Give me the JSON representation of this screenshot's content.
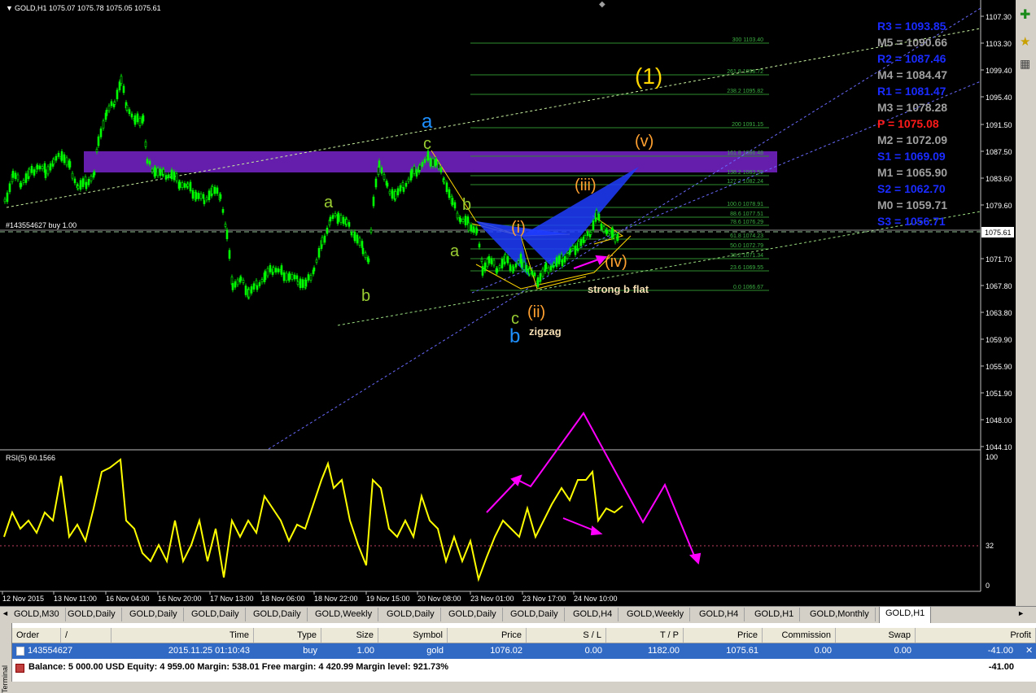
{
  "symbol_header": "GOLD,H1  1075.07 1075.78 1075.05 1075.61",
  "order_line_label": "#143554627 buy 1.00",
  "current_price_label": "1075.61",
  "price_axis": [
    "1107.30",
    "1103.30",
    "1099.40",
    "1095.40",
    "1091.50",
    "1087.50",
    "1083.60",
    "1079.60",
    "1075.61",
    "1071.70",
    "1067.80",
    "1063.80",
    "1059.90",
    "1055.90",
    "1051.90",
    "1048.00",
    "1044.10"
  ],
  "pivots": [
    {
      "label": "R3 = 1093.85",
      "color": "#1a2bff"
    },
    {
      "label": "M5 = 1090.66",
      "color": "#a0a0a0"
    },
    {
      "label": "R2 = 1087.46",
      "color": "#1a2bff"
    },
    {
      "label": "M4 = 1084.47",
      "color": "#a0a0a0"
    },
    {
      "label": "R1 = 1081.47",
      "color": "#1a2bff"
    },
    {
      "label": "M3 = 1078.28",
      "color": "#a0a0a0"
    },
    {
      "label": "P   = 1075.08",
      "color": "#ff1a1a"
    },
    {
      "label": "M2 = 1072.09",
      "color": "#a0a0a0"
    },
    {
      "label": "S1 = 1069.09",
      "color": "#1a2bff"
    },
    {
      "label": "M1 = 1065.90",
      "color": "#a0a0a0"
    },
    {
      "label": "S2 = 1062.70",
      "color": "#1a2bff"
    },
    {
      "label": "M0 = 1059.71",
      "color": "#a0a0a0"
    },
    {
      "label": "S3 = 1056.71",
      "color": "#1a2bff"
    }
  ],
  "fib_levels": [
    "300 1103.40",
    "261.8 1098.72",
    "238.2 1095.82",
    "200 1091.15",
    "161.8 1086.48",
    "138.2 1083.59",
    "127.2 1082.24",
    "100.0 1078.91",
    "88.6 1077.51",
    "78.6 1076.29",
    "61.8 1074.23",
    "50.0 1072.79",
    "38.2 1071.34",
    "23.6 1069.55",
    "0.0 1066.67"
  ],
  "wave_labels": {
    "w1": "(1)",
    "wv": "(v)",
    "wiii": "(iii)",
    "wi": "(i)",
    "wiv": "(iv)",
    "wii": "(ii)",
    "a_blue": "a",
    "b_blue": "b",
    "c_green1": "c",
    "c_green2": "c",
    "a_g1": "a",
    "b_g1": "b",
    "a_g2": "a",
    "b_g2": "b",
    "strong": "strong b flat",
    "zigzag": "zigzag"
  },
  "rsi_label": "RSI(5) 60.1566",
  "rsi_axis": [
    "100",
    "32",
    "0"
  ],
  "time_axis": [
    "12 Nov 2015",
    "13 Nov 11:00",
    "16 Nov 04:00",
    "16 Nov 20:00",
    "17 Nov 13:00",
    "18 Nov 06:00",
    "18 Nov 22:00",
    "19 Nov 15:00",
    "20 Nov 08:00",
    "23 Nov 01:00",
    "23 Nov 17:00",
    "24 Nov 10:00"
  ],
  "tabs": [
    "GOLD,M30",
    "GOLD,Daily",
    "GOLD,Daily",
    "GOLD,Daily",
    "GOLD,Daily",
    "GOLD,Weekly",
    "GOLD,Daily",
    "GOLD,Daily",
    "GOLD,Daily",
    "GOLD,H4",
    "GOLD,Weekly",
    "GOLD,H4",
    "GOLD,H1",
    "GOLD,Monthly",
    "GOLD,H1"
  ],
  "active_tab_index": 14,
  "terminal": {
    "side_label": "Terminal",
    "columns": [
      "Order",
      "/",
      "Time",
      "Type",
      "Size",
      "Symbol",
      "Price",
      "S / L",
      "T / P",
      "Price",
      "Commission",
      "Swap",
      "Profit"
    ],
    "row": {
      "order": "143554627",
      "time": "2015.11.25 01:10:43",
      "type": "buy",
      "size": "1.00",
      "symbol": "gold",
      "price": "1076.02",
      "sl": "0.00",
      "tp": "1182.00",
      "cur_price": "1075.61",
      "commission": "0.00",
      "swap": "0.00",
      "profit": "-41.00"
    },
    "balance_line": "Balance: 5 000.00 USD  Equity: 4 959.00  Margin: 538.01  Free margin: 4 420.99  Margin level: 921.73%",
    "balance_profit": "-41.00"
  },
  "colors": {
    "bull": "#00ff00",
    "bear": "#00ff00",
    "rsi": "#ffff00",
    "zone": "#6a1fb5",
    "wave_orange": "#ffa030",
    "wave_blue": "#1e90ff",
    "wave_green": "#9acd32",
    "magenta": "#ff00ff"
  }
}
